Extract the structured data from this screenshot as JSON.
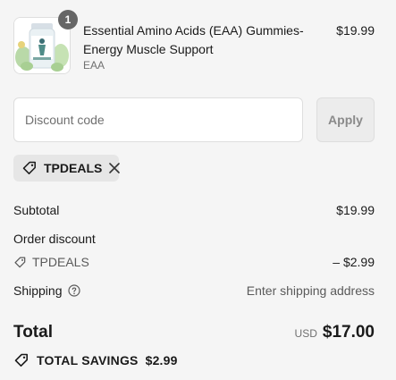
{
  "line_item": {
    "quantity": "1",
    "title": "Essential Amino Acids (EAA) Gummies-Energy Muscle Support",
    "variant": "EAA",
    "price": "$19.99"
  },
  "discount": {
    "placeholder": "Discount code",
    "value": "",
    "apply_label": "Apply",
    "applied_code": "TPDEALS"
  },
  "summary": {
    "subtotal_label": "Subtotal",
    "subtotal_value": "$19.99",
    "order_discount_label": "Order discount",
    "discount_code": "TPDEALS",
    "discount_value": "– $2.99",
    "shipping_label": "Shipping",
    "shipping_value": "Enter shipping address",
    "total_label": "Total",
    "currency": "USD",
    "total_value": "$17.00",
    "savings_label": "TOTAL SAVINGS",
    "savings_value": "$2.99"
  },
  "icons": {
    "tag": "tag-icon",
    "remove": "close-icon",
    "help": "help-circle-icon",
    "savings": "tag-icon"
  }
}
